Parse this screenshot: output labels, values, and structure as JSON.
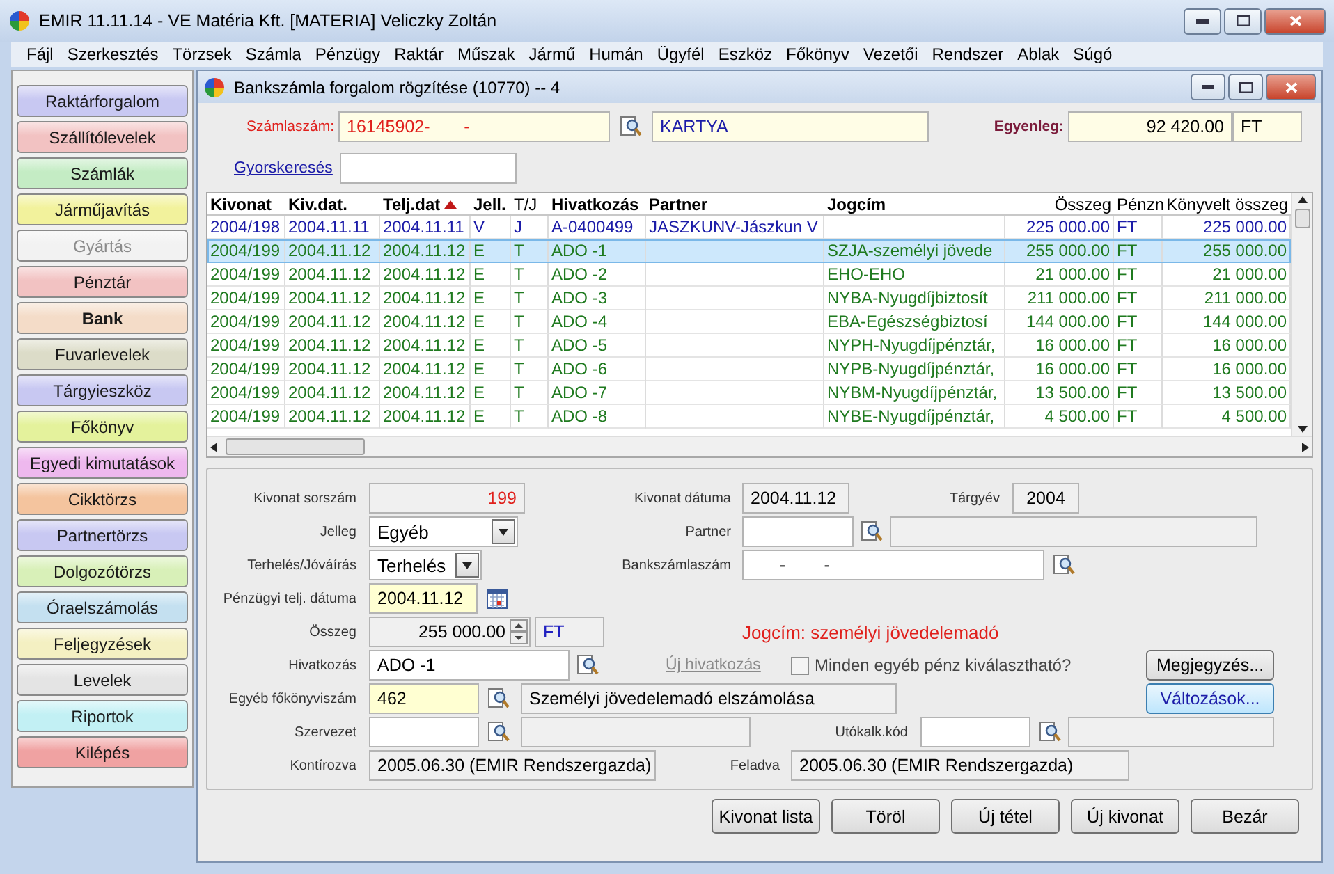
{
  "window": {
    "title": "EMIR 11.11.14 - VE Matéria Kft. [MATERIA] Veliczky Zoltán"
  },
  "menu": [
    "Fájl",
    "Szerkesztés",
    "Törzsek",
    "Számla",
    "Pénzügy",
    "Raktár",
    "Műszak",
    "Jármű",
    "Humán",
    "Ügyfél",
    "Eszköz",
    "Főkönyv",
    "Vezetői",
    "Rendszer",
    "Ablak",
    "Súgó"
  ],
  "sidebar": {
    "items": [
      {
        "label": "Raktárforgalom",
        "color": "#c8c8f2",
        "selected": false,
        "disabled": false
      },
      {
        "label": "Szállítólevelek",
        "color": "#f2c2c2",
        "selected": false,
        "disabled": false
      },
      {
        "label": "Számlák",
        "color": "#c4ecc4",
        "selected": false,
        "disabled": false
      },
      {
        "label": "Járműjavítás",
        "color": "#f2f29c",
        "selected": false,
        "disabled": false
      },
      {
        "label": "Gyártás",
        "color": "#f2f2f2",
        "selected": false,
        "disabled": true
      },
      {
        "label": "Pénztár",
        "color": "#f2c2c2",
        "selected": false,
        "disabled": false
      },
      {
        "label": "Bank",
        "color": "#f4dcc8",
        "selected": true,
        "disabled": false
      },
      {
        "label": "Fuvarlevelek",
        "color": "#dcdcc8",
        "selected": false,
        "disabled": false
      },
      {
        "label": "Tárgyieszköz",
        "color": "#c8c8f2",
        "selected": false,
        "disabled": false
      },
      {
        "label": "Főkönyv",
        "color": "#e4f29c",
        "selected": false,
        "disabled": false
      },
      {
        "label": "Egyedi kimutatások",
        "color": "#eeb8ee",
        "selected": false,
        "disabled": false
      },
      {
        "label": "Cikktörzs",
        "color": "#f4c49e",
        "selected": false,
        "disabled": false
      },
      {
        "label": "Partnertörzs",
        "color": "#c8c8f2",
        "selected": false,
        "disabled": false
      },
      {
        "label": "Dolgozótörzs",
        "color": "#d8f0b8",
        "selected": false,
        "disabled": false
      },
      {
        "label": "Óraelszámolás",
        "color": "#c4e0f0",
        "selected": false,
        "disabled": false
      },
      {
        "label": "Feljegyzések",
        "color": "#f4f0c2",
        "selected": false,
        "disabled": false
      },
      {
        "label": "Levelek",
        "color": "#e4e4e4",
        "selected": false,
        "disabled": false
      },
      {
        "label": "Riportok",
        "color": "#c2f0f4",
        "selected": false,
        "disabled": false
      },
      {
        "label": "Kilépés",
        "color": "#f0a2a2",
        "selected": false,
        "disabled": false
      }
    ]
  },
  "child_window": {
    "title": "Bankszámla forgalom rögzítése (10770) -- 4",
    "account": {
      "label": "Számlaszám:",
      "number": "16145902-       -",
      "name": "KARTYA"
    },
    "balance": {
      "label": "Egyenleg:",
      "value": "92 420.00",
      "currency": "FT"
    },
    "quick_search": {
      "label": "Gyorskeresés"
    },
    "table": {
      "columns": [
        {
          "label": "Kivonat",
          "emphasized": true,
          "sorted": false
        },
        {
          "label": "Kiv.dat.",
          "emphasized": true,
          "sorted": false
        },
        {
          "label": "Telj.dat",
          "emphasized": true,
          "sorted": true
        },
        {
          "label": "Jell.",
          "emphasized": true,
          "sorted": false
        },
        {
          "label": "T/J",
          "emphasized": false,
          "sorted": false
        },
        {
          "label": "Hivatkozás",
          "emphasized": true,
          "sorted": false
        },
        {
          "label": "Partner",
          "emphasized": true,
          "sorted": false
        },
        {
          "label": "Jogcím",
          "emphasized": true,
          "sorted": false
        },
        {
          "label": "Összeg",
          "emphasized": false,
          "sorted": false
        },
        {
          "label": "Pénzn",
          "emphasized": false,
          "sorted": false
        },
        {
          "label": "Könyvelt összeg",
          "emphasized": false,
          "sorted": false
        }
      ],
      "rows": [
        {
          "color": "#1c1ca8",
          "selected": false,
          "cells": [
            "2004/198",
            "2004.11.11",
            "2004.11.11",
            "V",
            "J",
            "A-0400499",
            "JASZKUNV-Jászkun V",
            "",
            "225 000.00",
            "FT",
            "225 000.00"
          ]
        },
        {
          "color": "#1f7a1f",
          "selected": true,
          "cells": [
            "2004/199",
            "2004.11.12",
            "2004.11.12",
            "E",
            "T",
            "ADO -1",
            "",
            "SZJA-személyi jövede",
            "255 000.00",
            "FT",
            "255 000.00"
          ]
        },
        {
          "color": "#1f7a1f",
          "selected": false,
          "cells": [
            "2004/199",
            "2004.11.12",
            "2004.11.12",
            "E",
            "T",
            "ADO -2",
            "",
            "EHO-EHO",
            "21 000.00",
            "FT",
            "21 000.00"
          ]
        },
        {
          "color": "#1f7a1f",
          "selected": false,
          "cells": [
            "2004/199",
            "2004.11.12",
            "2004.11.12",
            "E",
            "T",
            "ADO -3",
            "",
            "NYBA-Nyugdíjbiztosít",
            "211 000.00",
            "FT",
            "211 000.00"
          ]
        },
        {
          "color": "#1f7a1f",
          "selected": false,
          "cells": [
            "2004/199",
            "2004.11.12",
            "2004.11.12",
            "E",
            "T",
            "ADO -4",
            "",
            "EBA-Egészségbiztosí",
            "144 000.00",
            "FT",
            "144 000.00"
          ]
        },
        {
          "color": "#1f7a1f",
          "selected": false,
          "cells": [
            "2004/199",
            "2004.11.12",
            "2004.11.12",
            "E",
            "T",
            "ADO -5",
            "",
            "NYPH-Nyugdíjpénztár,",
            "16 000.00",
            "FT",
            "16 000.00"
          ]
        },
        {
          "color": "#1f7a1f",
          "selected": false,
          "cells": [
            "2004/199",
            "2004.11.12",
            "2004.11.12",
            "E",
            "T",
            "ADO -6",
            "",
            "NYPB-Nyugdíjpénztár,",
            "16 000.00",
            "FT",
            "16 000.00"
          ]
        },
        {
          "color": "#1f7a1f",
          "selected": false,
          "cells": [
            "2004/199",
            "2004.11.12",
            "2004.11.12",
            "E",
            "T",
            "ADO -7",
            "",
            "NYBM-Nyugdíjpénztár,",
            "13 500.00",
            "FT",
            "13 500.00"
          ]
        },
        {
          "color": "#1f7a1f",
          "selected": false,
          "cells": [
            "2004/199",
            "2004.11.12",
            "2004.11.12",
            "E",
            "T",
            "ADO -8",
            "",
            "NYBE-Nyugdíjpénztár,",
            "4 500.00",
            "FT",
            "4 500.00"
          ]
        }
      ]
    },
    "form": [
      [
        {
          "kind": "label",
          "text": "Kivonat sorszám"
        },
        {
          "kind": "field",
          "readonly": true,
          "required": false,
          "value": "199",
          "color": "#e0201c"
        },
        {
          "kind": "label",
          "text": "Kivonat dátuma"
        },
        {
          "kind": "field",
          "readonly": true,
          "required": false,
          "value": "2004.11.12"
        },
        {
          "kind": "label",
          "text": "Tárgyév"
        },
        {
          "kind": "field",
          "readonly": true,
          "required": false,
          "value": "2004"
        }
      ],
      [
        {
          "kind": "label",
          "text": "Jelleg"
        },
        {
          "kind": "select",
          "value": "Egyéb"
        },
        {
          "kind": "label",
          "text": "Partner"
        },
        {
          "kind": "field",
          "readonly": false,
          "required": false
        },
        {
          "kind": "lookup"
        },
        {
          "kind": "field",
          "readonly": true,
          "required": false
        }
      ],
      [
        {
          "kind": "label",
          "text": "Terhelés/Jóváírás"
        },
        {
          "kind": "select",
          "value": "Terhelés"
        },
        {
          "kind": "label",
          "text": "Bankszámlaszám"
        },
        {
          "kind": "field",
          "readonly": false,
          "required": false,
          "value": "      -        -"
        },
        {
          "kind": "lookup"
        }
      ],
      [
        {
          "kind": "label",
          "text": "Pénzügyi telj. dátuma"
        },
        {
          "kind": "field",
          "readonly": false,
          "required": true,
          "value": "2004.11.12"
        },
        {
          "kind": "calendar"
        }
      ],
      [
        {
          "kind": "label",
          "text": "Összeg"
        },
        {
          "kind": "spin",
          "value": "255 000.00"
        },
        {
          "kind": "field",
          "readonly": true,
          "required": false,
          "value": "FT",
          "color": "#2020c0"
        },
        {
          "kind": "note",
          "text": "Jogcím: személyi jövedelemadó"
        }
      ],
      [
        {
          "kind": "label",
          "text": "Hivatkozás"
        },
        {
          "kind": "field",
          "readonly": false,
          "required": false,
          "value": "ADO -1"
        },
        {
          "kind": "lookup"
        },
        {
          "kind": "link",
          "text": "Új hivatkozás",
          "disabled": true
        },
        {
          "kind": "checkbox",
          "text": "Minden egyéb pénz kiválasztható?",
          "checked": false
        },
        {
          "kind": "button",
          "text": "Megjegyzés...",
          "highlighted": false
        }
      ],
      [
        {
          "kind": "label",
          "text": "Egyéb főkönyviszám"
        },
        {
          "kind": "field",
          "readonly": false,
          "required": true,
          "value": "462"
        },
        {
          "kind": "lookup"
        },
        {
          "kind": "field",
          "readonly": true,
          "required": false,
          "value": "Személyi jövedelemadó elszámolása"
        },
        {
          "kind": "button",
          "text": "Változások...",
          "highlighted": true
        }
      ],
      [
        {
          "kind": "label",
          "text": "Szervezet"
        },
        {
          "kind": "field",
          "readonly": false,
          "required": false
        },
        {
          "kind": "lookup"
        },
        {
          "kind": "field",
          "readonly": true,
          "required": false
        },
        {
          "kind": "label",
          "text": "Utókalk.kód"
        },
        {
          "kind": "field",
          "readonly": false,
          "required": false
        },
        {
          "kind": "lookup"
        },
        {
          "kind": "field",
          "readonly": true,
          "required": false
        }
      ],
      [
        {
          "kind": "label",
          "text": "Kontírozva"
        },
        {
          "kind": "field",
          "readonly": true,
          "required": false,
          "value": "2005.06.30 (EMIR Rendszergazda)"
        },
        {
          "kind": "label",
          "text": "Feladva"
        },
        {
          "kind": "field",
          "readonly": true,
          "required": false,
          "value": "2005.06.30 (EMIR Rendszergazda)"
        }
      ]
    ],
    "buttons": [
      "Kivonat lista",
      "Töröl",
      "Új tétel",
      "Új kivonat",
      "Bezár"
    ]
  }
}
